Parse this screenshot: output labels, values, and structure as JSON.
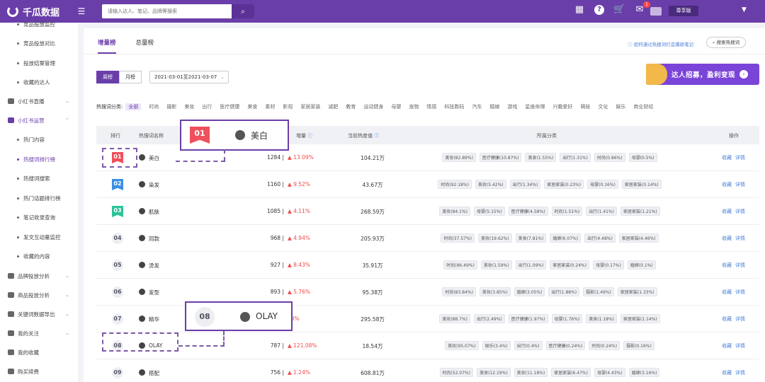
{
  "app": {
    "name": "千瓜数据",
    "menu_icon": "menu-toggle-icon"
  },
  "search": {
    "placeholder": "请输入达人、笔记、品牌等搜索"
  },
  "top_icons": {
    "notification_count": "1",
    "vip_label": "尊享版"
  },
  "sidebar": {
    "items": [
      {
        "type": "sub",
        "label": "竞品投放监控"
      },
      {
        "type": "sub",
        "label": "竞品投放对比"
      },
      {
        "type": "sub",
        "label": "投放结案管理"
      },
      {
        "type": "sub",
        "label": "收藏的达人"
      },
      {
        "type": "group",
        "label": "小红书直播"
      },
      {
        "type": "group",
        "label": "小红书运营",
        "active": true
      },
      {
        "type": "sub",
        "label": "热门内容"
      },
      {
        "type": "sub",
        "label": "热搜词排行榜",
        "active": true
      },
      {
        "type": "sub",
        "label": "热搜词搜索"
      },
      {
        "type": "sub",
        "label": "热门话题排行榜"
      },
      {
        "type": "sub",
        "label": "笔记收录查询"
      },
      {
        "type": "sub",
        "label": "发文互动量监控"
      },
      {
        "type": "sub",
        "label": "收藏的内容"
      },
      {
        "type": "group",
        "label": "品牌投放分析"
      },
      {
        "type": "group",
        "label": "商品投放分析"
      },
      {
        "type": "group",
        "label": "关键词数据导出"
      },
      {
        "type": "group",
        "label": "我的关注"
      },
      {
        "type": "group",
        "label": "我的收藏"
      },
      {
        "type": "group",
        "label": "购买续费"
      }
    ]
  },
  "tabs": [
    {
      "label": "增量榜",
      "active": true
    },
    {
      "label": "总量榜"
    }
  ],
  "howto_link": "如何通过热搜词打造爆款笔记",
  "hot_search_button": "搜索热搜词",
  "period": {
    "week": "周榜",
    "month": "月榜",
    "date_range": "2021-03-01至2021-03-07"
  },
  "banner": {
    "text": "达人招募，盈利变现"
  },
  "categories": {
    "label": "热搜词分类:",
    "items": [
      "全部",
      "时尚",
      "摄影",
      "美妆",
      "出行",
      "医疗健康",
      "美食",
      "素材",
      "影视",
      "家居家装",
      "减肥",
      "教育",
      "运动健身",
      "母婴",
      "宠物",
      "情感",
      "科技数码",
      "汽车",
      "婚嫁",
      "游戏",
      "星座命理",
      "兴趣爱好",
      "萌娃",
      "文化",
      "娱乐",
      "商业财经"
    ]
  },
  "table": {
    "headers": {
      "rank": "排行",
      "keyword": "热搜词名称",
      "increment": "増量",
      "current_heat": "当前热度值",
      "category": "所属分类",
      "ops": "操作"
    },
    "op_collect": "收藏",
    "op_detail": "详情",
    "rows": [
      {
        "rank": "01",
        "keyword": "美白",
        "value": "1284 |",
        "change": "▲ 13.09%",
        "heat": "104.21万",
        "tags": [
          "美妆(82.89%)",
          "医疗健康(10.87%)",
          "美食(1.55%)",
          "出行(1.31%)",
          "时尚(0.86%)",
          "母婴(0.5%)"
        ]
      },
      {
        "rank": "02",
        "keyword": "染发",
        "value": "1160 |",
        "change": "▲ 9.52%",
        "heat": "43.67万",
        "tags": [
          "时尚(92.18%)",
          "美妆(5.42%)",
          "出行(1.34%)",
          "家居家装(0.23%)",
          "母婴(0.16%)",
          "家居家装(0.14%)"
        ]
      },
      {
        "rank": "03",
        "keyword": "肌肤",
        "value": "1085 |",
        "change": "▲ 4.11%",
        "heat": "268.59万",
        "tags": [
          "美妆(84.1%)",
          "母婴(5.15%)",
          "医疗健康(4.58%)",
          "时尚(1.51%)",
          "出行(1.41%)",
          "家居家装(1.21%)"
        ]
      },
      {
        "rank": "04",
        "keyword": "同款",
        "value": "968 |",
        "change": "▲ 4.94%",
        "heat": "205.93万",
        "tags": [
          "时尚(37.57%)",
          "美妆(19.62%)",
          "美食(7.81%)",
          "婚嫁(6.07%)",
          "出行(4.48%)",
          "家居家装(4.46%)"
        ]
      },
      {
        "rank": "05",
        "keyword": "烫发",
        "value": "927 |",
        "change": "▲ 8.43%",
        "heat": "35.91万",
        "tags": [
          "时尚(96.49%)",
          "美妆(1.59%)",
          "出行(1.09%)",
          "家居家装(0.24%)",
          "母婴(0.17%)",
          "婚嫁(0.1%)"
        ]
      },
      {
        "rank": "06",
        "keyword": "发型",
        "value": "893 |",
        "change": "▲ 5.76%",
        "heat": "95.38万",
        "tags": [
          "时尚(83.84%)",
          "美妆(3.85%)",
          "婚嫁(3.05%)",
          "出行(1.88%)",
          "摄影(1.49%)",
          "家居家装(1.33%)"
        ]
      },
      {
        "rank": "07",
        "keyword": "精华",
        "value": "",
        "change": "19%",
        "heat": "295.58万",
        "tags": [
          "美妆(88.7%)",
          "出行(2.49%)",
          "医疗健康(1.97%)",
          "母婴(1.76%)",
          "美食(1.18%)",
          "家居家装(1.14%)"
        ]
      },
      {
        "rank": "08",
        "keyword": "OLAY",
        "value": "787 |",
        "change": "▲ 121.08%",
        "heat": "18.54万",
        "tags": [
          "美妆(95.07%)",
          "娱乐(3.4%)",
          "出行(0.4%)",
          "医疗健康(0.24%)",
          "时尚(0.24%)",
          "摄影(0.16%)"
        ]
      },
      {
        "rank": "09",
        "keyword": "搭配",
        "value": "756 |",
        "change": "▲ 1.24%",
        "heat": "608.81万",
        "tags": [
          "时尚(52.07%)",
          "美食(12.19%)",
          "美妆(11.18%)",
          "家居家装(6.47%)",
          "母婴(4.43%)",
          "婚嫁(3.16%)"
        ]
      }
    ]
  },
  "callouts": [
    {
      "rank": "01",
      "keyword": "美白"
    },
    {
      "rank": "08",
      "keyword": "OLAY"
    }
  ],
  "colors": {
    "brand": "#6a3ea8",
    "rank1": "#f0505c",
    "rank2": "#3a8ee6",
    "rank3": "#2cc29a",
    "up": "#f04a4a",
    "link": "#4a7fd8"
  }
}
